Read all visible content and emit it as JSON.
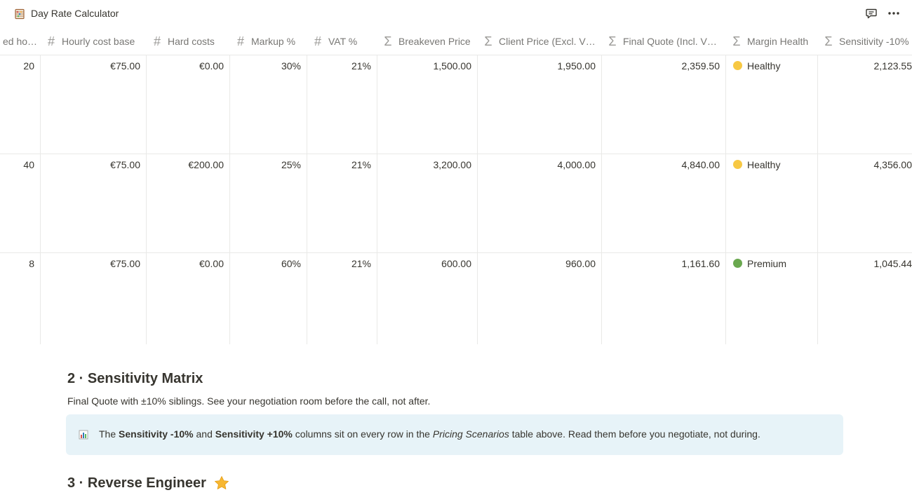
{
  "page": {
    "title": "Day Rate Calculator",
    "icon": "abacus-icon"
  },
  "topbar": {
    "comments_icon": "comment-icon",
    "more_icon": "more-horizontal-icon"
  },
  "table": {
    "columns": [
      {
        "label": "ed hours",
        "type": "none"
      },
      {
        "label": "Hourly cost base",
        "type": "number"
      },
      {
        "label": "Hard costs",
        "type": "number"
      },
      {
        "label": "Markup %",
        "type": "number"
      },
      {
        "label": "VAT %",
        "type": "number"
      },
      {
        "label": "Breakeven Price",
        "type": "formula"
      },
      {
        "label": "Client Price (Excl. V…",
        "type": "formula"
      },
      {
        "label": "Final Quote (Incl. V…",
        "type": "formula"
      },
      {
        "label": "Margin Health",
        "type": "formula"
      },
      {
        "label": "Sensitivity -10%",
        "type": "formula"
      }
    ],
    "rows": [
      {
        "hours": "20",
        "hourly": "€75.00",
        "hard": "€0.00",
        "markup": "30%",
        "vat": "21%",
        "breakeven": "1,500.00",
        "client": "1,950.00",
        "final": "2,359.50",
        "health": "Healthy",
        "health_color": "#f7c843",
        "sens": "2,123.55"
      },
      {
        "hours": "40",
        "hourly": "€75.00",
        "hard": "€200.00",
        "markup": "25%",
        "vat": "21%",
        "breakeven": "3,200.00",
        "client": "4,000.00",
        "final": "4,840.00",
        "health": "Healthy",
        "health_color": "#f7c843",
        "sens": "4,356.00"
      },
      {
        "hours": "8",
        "hourly": "€75.00",
        "hard": "€0.00",
        "markup": "60%",
        "vat": "21%",
        "breakeven": "600.00",
        "client": "960.00",
        "final": "1,161.60",
        "health": "Premium",
        "health_color": "#6aa84f",
        "sens": "1,045.44"
      }
    ]
  },
  "section2": {
    "heading": "2 · Sensitivity Matrix",
    "subtitle": "Final Quote with ±10% siblings. See your negotiation room before the call, not after.",
    "callout": {
      "icon": "bar-chart-icon",
      "t1": "The ",
      "b1": "Sensitivity -10%",
      "t2": " and ",
      "b2": "Sensitivity +10%",
      "t3": " columns sit on every row in the ",
      "i1": "Pricing Scenarios",
      "t4": " table above. Read them before you negotiate, not during."
    }
  },
  "section3": {
    "heading": "3 · Reverse Engineer",
    "icon": "star-icon"
  }
}
